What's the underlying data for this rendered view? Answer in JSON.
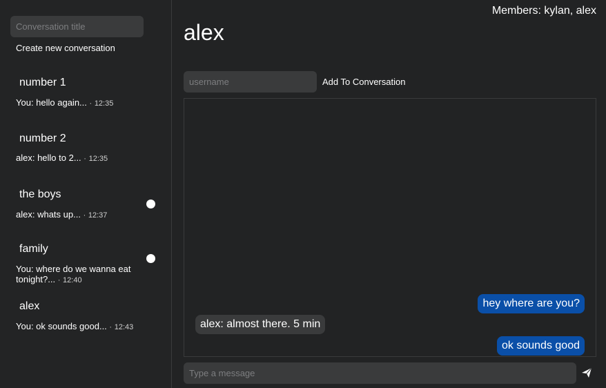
{
  "sidebar": {
    "title_placeholder": "Conversation title",
    "create_label": "Create new conversation",
    "conversations": [
      {
        "name": "number 1",
        "preview": "You: hello again...",
        "time": "12:35",
        "unread": false
      },
      {
        "name": "number 2",
        "preview": "alex: hello to 2...",
        "time": "12:35",
        "unread": false
      },
      {
        "name": "the boys",
        "preview": "alex: whats up...",
        "time": "12:37",
        "unread": true
      },
      {
        "name": "family",
        "preview": "You: where do we wanna eat tonight?...",
        "time": "12:40",
        "unread": true
      },
      {
        "name": "alex",
        "preview": "You: ok sounds good...",
        "time": "12:43",
        "unread": false
      }
    ],
    "time_separator": "·"
  },
  "header": {
    "members": "Members: kylan, alex",
    "title": "alex"
  },
  "add_member": {
    "username_placeholder": "username",
    "add_label": "Add To Conversation"
  },
  "messages": [
    {
      "text": "hey where are you?",
      "direction": "sent"
    },
    {
      "text": "alex: almost there. 5 min",
      "direction": "received"
    },
    {
      "text": "ok sounds good",
      "direction": "sent"
    }
  ],
  "composer": {
    "placeholder": "Type a message",
    "send_icon": "send-icon"
  },
  "colors": {
    "background": "#222324",
    "input_bg": "#3a3b3c",
    "sent_bubble": "#0a4fa8",
    "received_bubble": "#3a3b3c",
    "border": "#3a3b3c"
  }
}
